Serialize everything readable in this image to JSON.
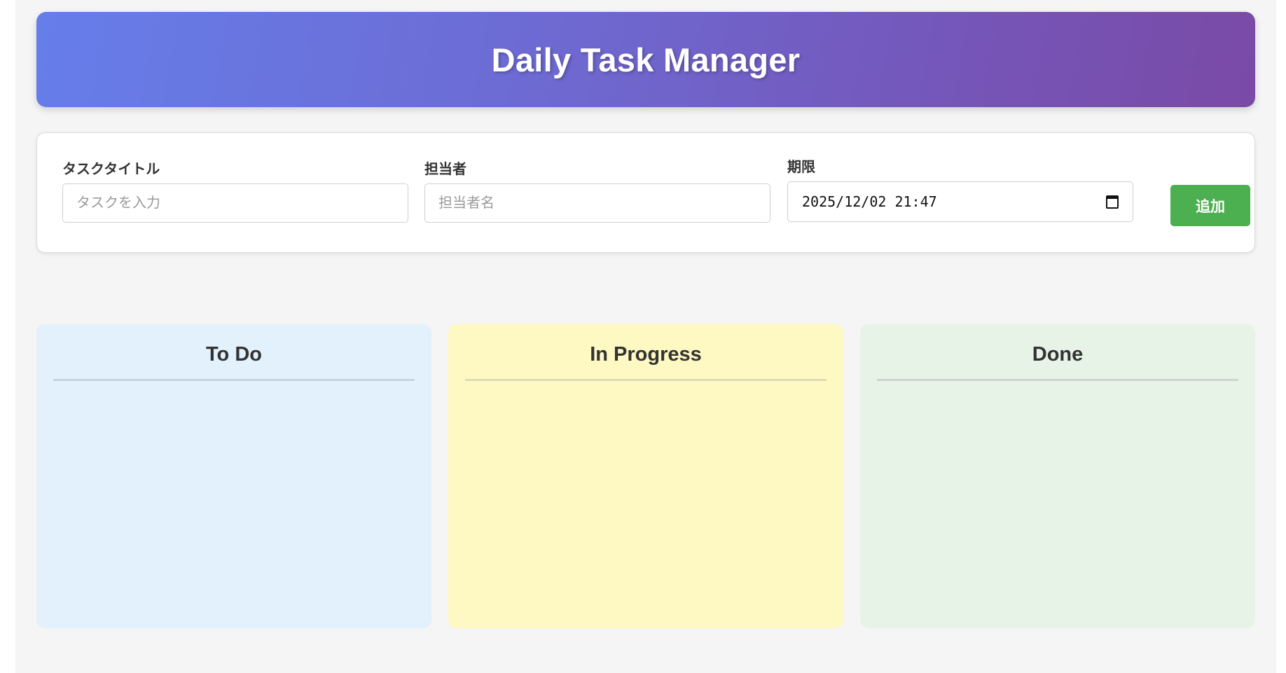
{
  "header": {
    "title": "Daily Task Manager"
  },
  "form": {
    "title_field": {
      "label": "タスクタイトル",
      "placeholder": "タスクを入力",
      "value": ""
    },
    "assignee_field": {
      "label": "担当者",
      "placeholder": "担当者名",
      "value": ""
    },
    "due_field": {
      "label": "期限",
      "value": "2025/12/02  21:47"
    },
    "add_label": "追加"
  },
  "columns": [
    {
      "title": "To Do",
      "tasks": []
    },
    {
      "title": "In Progress",
      "tasks": []
    },
    {
      "title": "Done",
      "tasks": []
    }
  ],
  "colors": {
    "header_gradient_start": "#667eea",
    "header_gradient_end": "#7a4aa6",
    "add_button": "#4caf50",
    "todo_bg": "#e3f1fc",
    "progress_bg": "#fef8c3",
    "done_bg": "#e8f3e7"
  }
}
